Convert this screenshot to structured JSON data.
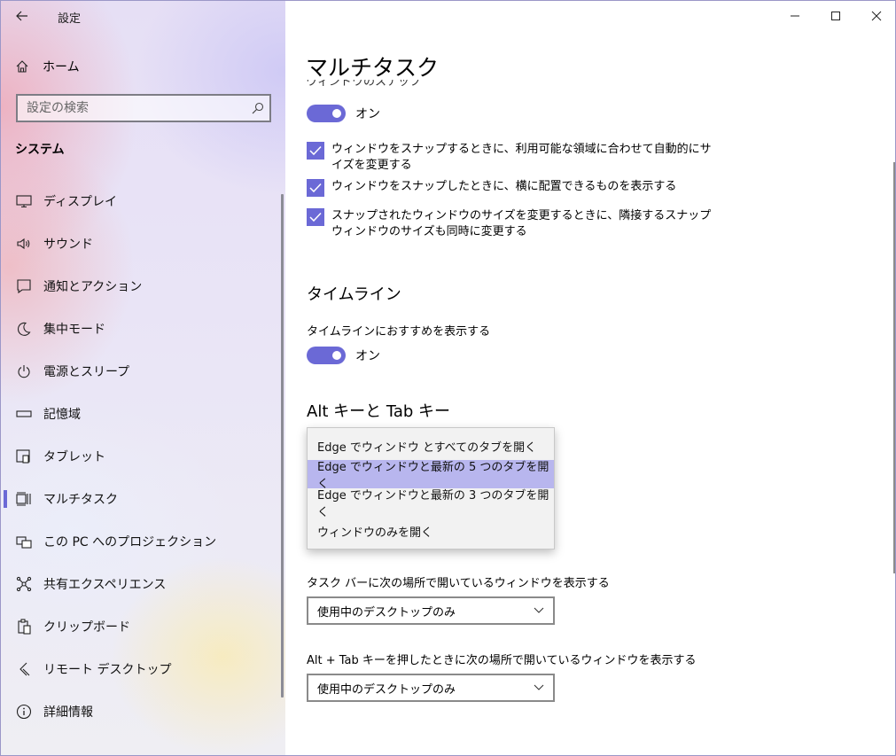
{
  "app": {
    "title": "設定"
  },
  "sidebar": {
    "home_label": "ホーム",
    "search_placeholder": "設定の検索",
    "section_title": "システム",
    "items": [
      {
        "label": "ディスプレイ",
        "icon": "monitor-icon"
      },
      {
        "label": "サウンド",
        "icon": "speaker-icon"
      },
      {
        "label": "通知とアクション",
        "icon": "message-icon"
      },
      {
        "label": "集中モード",
        "icon": "moon-icon"
      },
      {
        "label": "電源とスリープ",
        "icon": "power-icon"
      },
      {
        "label": "記憶域",
        "icon": "storage-icon"
      },
      {
        "label": "タブレット",
        "icon": "tablet-icon"
      },
      {
        "label": "マルチタスク",
        "icon": "multitask-icon",
        "active": true
      },
      {
        "label": "この PC へのプロジェクション",
        "icon": "projection-icon"
      },
      {
        "label": "共有エクスペリエンス",
        "icon": "share-icon"
      },
      {
        "label": "クリップボード",
        "icon": "clipboard-icon"
      },
      {
        "label": "リモート デスクトップ",
        "icon": "remote-icon"
      },
      {
        "label": "詳細情報",
        "icon": "info-icon"
      }
    ]
  },
  "main": {
    "title": "マルチタスク",
    "snap": {
      "heading_cut": "ウィンドウのスナップ",
      "toggle_label": "オン",
      "options": [
        "ウィンドウをスナップするときに、利用可能な領域に合わせて自動的にサイズを変更する",
        "ウィンドウをスナップしたときに、横に配置できるものを表示する",
        "スナップされたウィンドウのサイズを変更するときに、隣接するスナップ ウィンドウのサイズも同時に変更する"
      ]
    },
    "timeline": {
      "heading": "タイムライン",
      "label": "タイムラインにおすすめを表示する",
      "toggle_label": "オン"
    },
    "alttab": {
      "heading": "Alt キーと Tab キー",
      "dropdown_options": [
        "Edge でウィンドウ とすべてのタブを開く",
        "Edge でウィンドウと最新の 5 つのタブを開く",
        "Edge でウィンドウと最新の 3 つのタブを開く",
        "ウィンドウのみを開く"
      ],
      "selected_index": 1
    },
    "desktops": {
      "taskbar_label": "タスク バーに次の場所で開いているウィンドウを表示する",
      "taskbar_value": "使用中のデスクトップのみ",
      "alttab_label": "Alt + Tab キーを押したときに次の場所で開いているウィンドウを表示する",
      "alttab_value": "使用中のデスクトップのみ"
    }
  },
  "colors": {
    "accent": "#6b69d6",
    "selected_option": "#b8b6ee"
  }
}
